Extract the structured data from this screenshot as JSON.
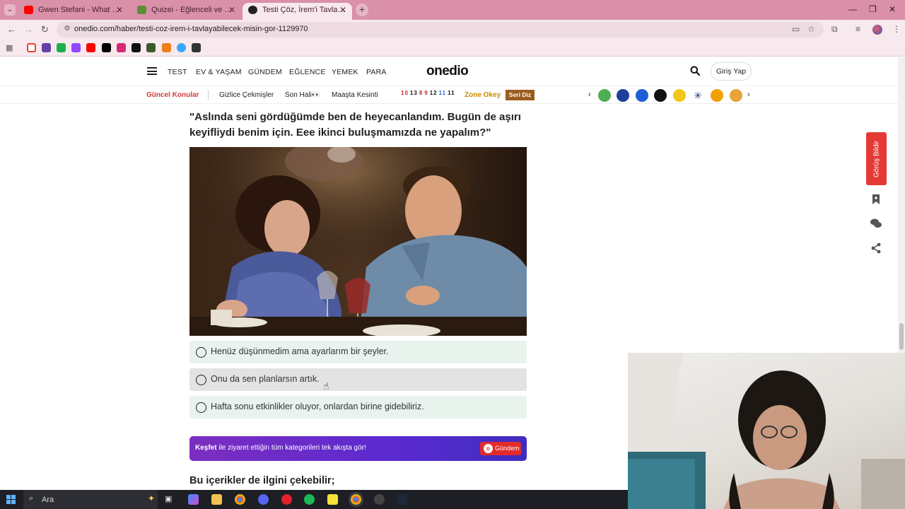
{
  "browser": {
    "tabs": [
      {
        "title": "Gwen Stefani - What You Waiti",
        "favicon_color": "#ff0000",
        "active": false
      },
      {
        "title": "Quizei - Eğlenceli ve etkileşimi",
        "favicon_color": "#5b8f3a",
        "active": false
      },
      {
        "title": "Testi Çöz, İrem'i Tavlayabilece",
        "favicon_color": "#222222",
        "active": true
      }
    ],
    "url": "onedio.com/haber/testi-coz-irem-i-tavlayabilecek-misin-gor-1129970",
    "bookmarks": [
      "gmail-icon",
      "twitch-icon",
      "kick-icon",
      "twitch-icon",
      "youtube-icon",
      "x-icon",
      "instagram-icon",
      "tiktok-icon",
      "app-icon",
      "app-icon",
      "app-icon",
      "app-icon"
    ]
  },
  "site": {
    "logo": "onedio",
    "nav": [
      "TEST",
      "EV & YAŞAM",
      "GÜNDEM",
      "EĞLENCE",
      "YEMEK",
      "PARA"
    ],
    "login": "Giriş Yap",
    "subnav": {
      "highlight": "Güncel Konular",
      "links": [
        "Gizlice Çekmişler",
        "Son Hali👀",
        "Maaşta Kesinti"
      ],
      "numbers": [
        "10",
        "13",
        "8",
        "9",
        "12",
        "11",
        "11"
      ],
      "zone": "Zone Okey",
      "seri": "Seri Diz"
    }
  },
  "article": {
    "question": "\"Aslında seni gördüğümde ben de heyecanlandım. Bugün de aşırı keyifliydi benim için. Eee ikinci buluşmamızda ne yapalım?\"",
    "options": [
      "Henüz düşünmedim ama ayarlarım bir şeyler.",
      "Onu da sen planlarsın artık.",
      "Hafta sonu etkinlikler oluyor, onlardan birine gidebiliriz."
    ],
    "kesfet_bold": "Keşfet",
    "kesfet_text": " ile ziyaret ettiğin tüm kategorileri tek akışta gör!",
    "gundem_button": "Gündem",
    "related_heading": "Bu içerikler de ilgini çekebilir;"
  },
  "side_tools": {
    "report": "Görüş Bildir"
  },
  "taskbar": {
    "search_placeholder": "Ara"
  }
}
